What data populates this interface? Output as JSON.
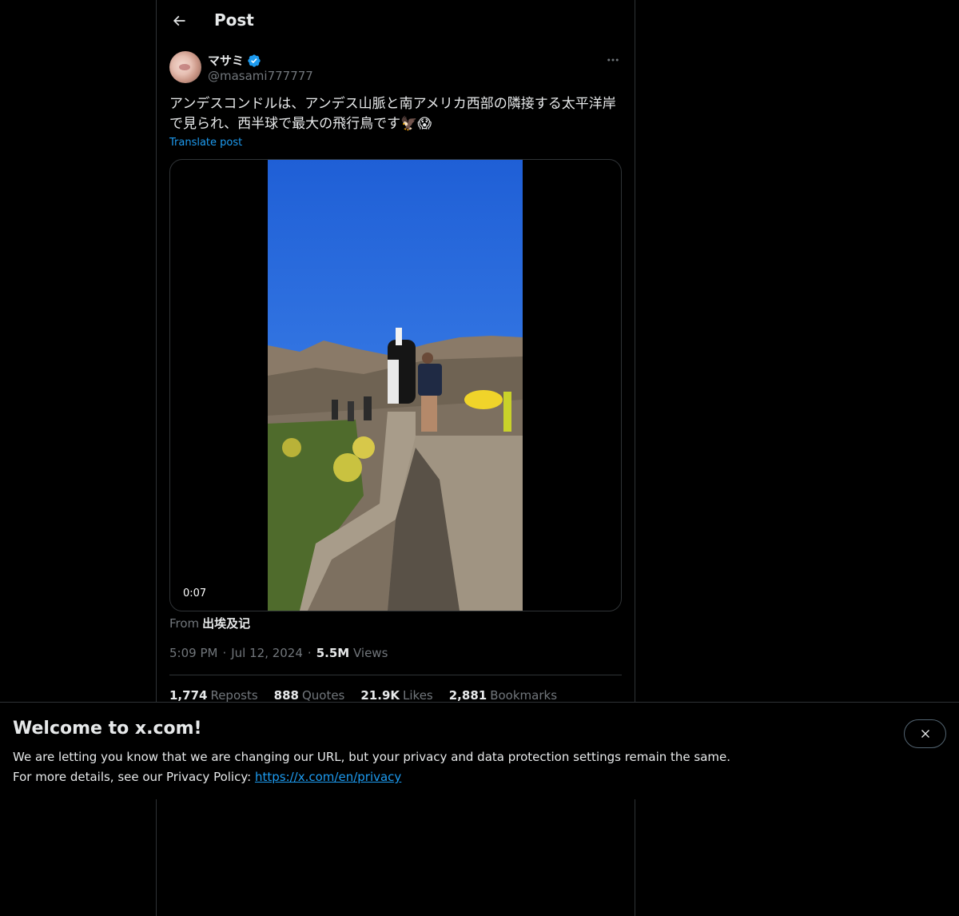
{
  "header": {
    "title": "Post"
  },
  "author": {
    "name": "マサミ",
    "handle": "@masami777777"
  },
  "post": {
    "text": "アンデスコンドルは、アンデス山脈と南アメリカ西部の隣接する太平洋岸で見られ、西半球で最大の飛行鳥です🦅😱",
    "translate_label": "Translate post"
  },
  "media": {
    "duration": "0:07"
  },
  "source": {
    "prefix": "From",
    "name": "出埃及记"
  },
  "meta": {
    "time": "5:09 PM",
    "separator": "·",
    "date": "Jul 12, 2024",
    "views_count": "5.5M",
    "views_label": "Views"
  },
  "stats": [
    {
      "count": "1,774",
      "label": "Reposts"
    },
    {
      "count": "888",
      "label": "Quotes"
    },
    {
      "count": "21.9K",
      "label": "Likes"
    },
    {
      "count": "2,881",
      "label": "Bookmarks"
    }
  ],
  "banner": {
    "title": "Welcome to x.com!",
    "line1": "We are letting you know that we are changing our URL, but your privacy and data protection settings remain the same.",
    "line2_prefix": "For more details, see our Privacy Policy:",
    "link": "https://x.com/en/privacy"
  },
  "colors": {
    "accent": "#1d9bf0",
    "background": "#000000",
    "muted": "#71767b",
    "text": "#e7e9ea"
  },
  "icons": {
    "back": "arrow-left-icon",
    "verified": "verified-badge-icon",
    "more": "more-horizontal-icon",
    "close": "close-icon"
  }
}
